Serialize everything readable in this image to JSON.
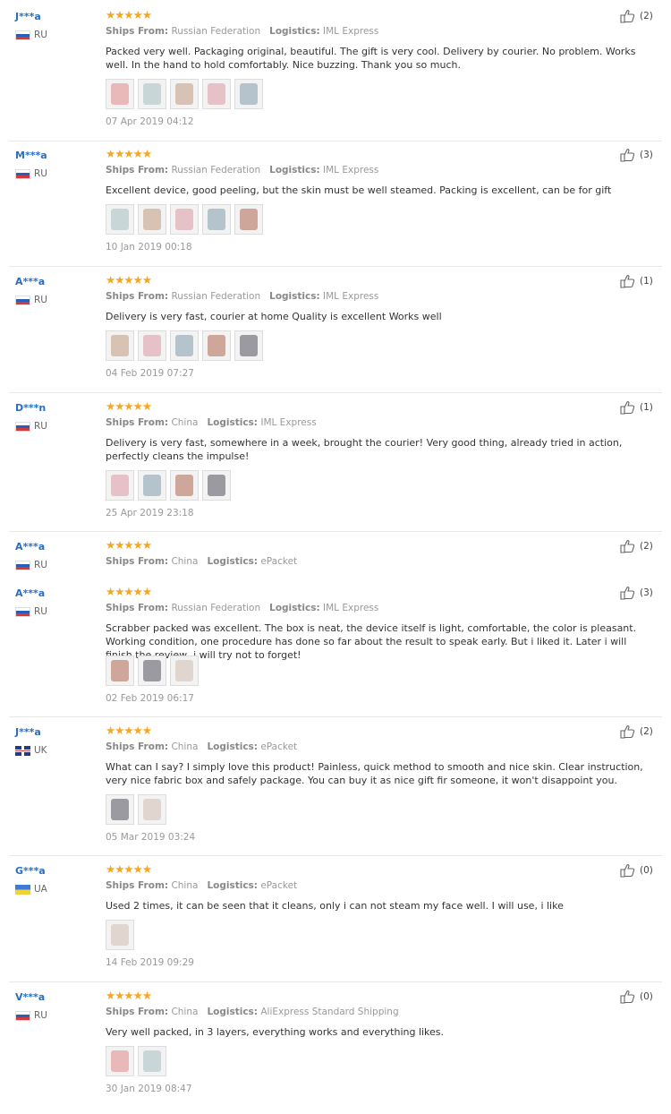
{
  "labels": {
    "ships_from": "Ships From:",
    "logistics": "Logistics:"
  },
  "reviews": [
    {
      "user": "J***a",
      "country": "RU",
      "flag": "ru",
      "stars": "★★★★★",
      "ships": "Russian Federation",
      "logistics": "IML Express",
      "text": "Packed very well. Packaging original, beautiful. The gift is very cool. Delivery by courier. No problem. Works well. In the hand to hold comfortably. Nice buzzing. Thank you so much.",
      "date": "07 Apr 2019 04:12",
      "likes": "(2)",
      "photos": 5
    },
    {
      "user": "M***a",
      "country": "RU",
      "flag": "ru",
      "stars": "★★★★★",
      "ships": "Russian Federation",
      "logistics": "IML Express",
      "text": "Excellent device, good peeling, but the skin must be well steamed. Packing is excellent, can be for gift",
      "date": "10 Jan 2019 00:18",
      "likes": "(3)",
      "photos": 5
    },
    {
      "user": "A***a",
      "country": "RU",
      "flag": "ru",
      "stars": "★★★★★",
      "ships": "Russian Federation",
      "logistics": "IML Express",
      "text": "Delivery is very fast, courier at home Quality is excellent Works well",
      "date": "04 Feb 2019 07:27",
      "likes": "(1)",
      "photos": 5
    },
    {
      "user": "D***n",
      "country": "RU",
      "flag": "ru",
      "stars": "★★★★★",
      "ships": "China",
      "logistics": "IML Express",
      "text": "Delivery is very fast, somewhere in a week, brought the courier! Very good thing, already tried in action, perfectly cleans the impulse!",
      "date": "25 Apr 2019 23:18",
      "likes": "(1)",
      "photos": 4
    },
    {
      "user": "A***a",
      "country": "RU",
      "flag": "ru",
      "stars": "★★★★★",
      "ships": "China",
      "logistics": "ePacket",
      "text": "",
      "date": "",
      "likes": "(2)",
      "photos": 0
    },
    {
      "user": "A***a",
      "country": "RU",
      "flag": "ru",
      "stars": "★★★★★",
      "ships": "Russian Federation",
      "logistics": "IML Express",
      "text": "Scrabber packed was excellent. The box is neat, the device itself is light, comfortable, the color is pleasant. Working condition, one procedure has done so far about the result to speak early. But i liked it. Later i will finish the review, i will try not to forget!",
      "date": "02 Feb 2019 06:17",
      "likes": "(3)",
      "photos": 3
    },
    {
      "user": "J***a",
      "country": "UK",
      "flag": "uk",
      "stars": "★★★★★",
      "ships": "China",
      "logistics": "ePacket",
      "text": "What can I say? I simply love this product! Painless, quick method to smooth and nice skin. Clear instruction, very nice fabric box and safely package. You can buy it as nice gift fir someone, it won't disappoint you.",
      "date": "05 Mar 2019 03:24",
      "likes": "(2)",
      "photos": 2
    },
    {
      "user": "G***a",
      "country": "UA",
      "flag": "ua",
      "stars": "★★★★★",
      "ships": "China",
      "logistics": "ePacket",
      "text": "Used 2 times, it can be seen that it cleans, only i can not steam my face well. I will use, i like",
      "date": "14 Feb 2019 09:29",
      "likes": "(0)",
      "photos": 1
    },
    {
      "user": "V***a",
      "country": "RU",
      "flag": "ru",
      "stars": "★★★★★",
      "ships": "China",
      "logistics": "AliExpress Standard Shipping",
      "text": "Very well packed, in 3 layers, everything works and everything likes.",
      "date": "30 Jan 2019 08:47",
      "likes": "(0)",
      "photos": 2
    }
  ]
}
